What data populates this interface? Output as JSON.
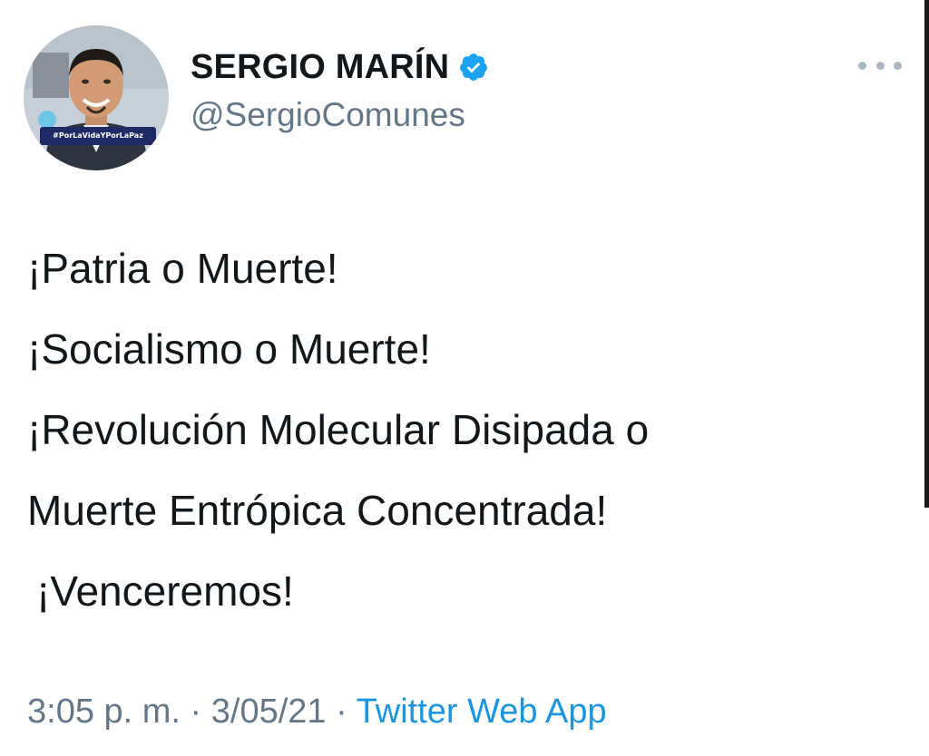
{
  "author": {
    "display_name": "SERGIO MARÍN",
    "handle": "@SergioComunes",
    "verified": true,
    "avatar_banner_text": "#PorLaVidaYPorLaPaz"
  },
  "tweet": {
    "lines": [
      "¡Patria o Muerte!",
      "¡Socialismo o Muerte!",
      "¡Revolución Molecular Disipada o",
      "Muerte Entrópica Concentrada!",
      "¡Venceremos!"
    ]
  },
  "meta": {
    "time": "3:05 p. m.",
    "separator": "·",
    "date": "3/05/21",
    "source": "Twitter Web App"
  },
  "icons": {
    "verified": "verified-badge-icon",
    "more": "more-options-icon"
  },
  "colors": {
    "verified_blue": "#1da1f2",
    "link_blue": "#1b95e0",
    "muted_gray": "#657786"
  }
}
